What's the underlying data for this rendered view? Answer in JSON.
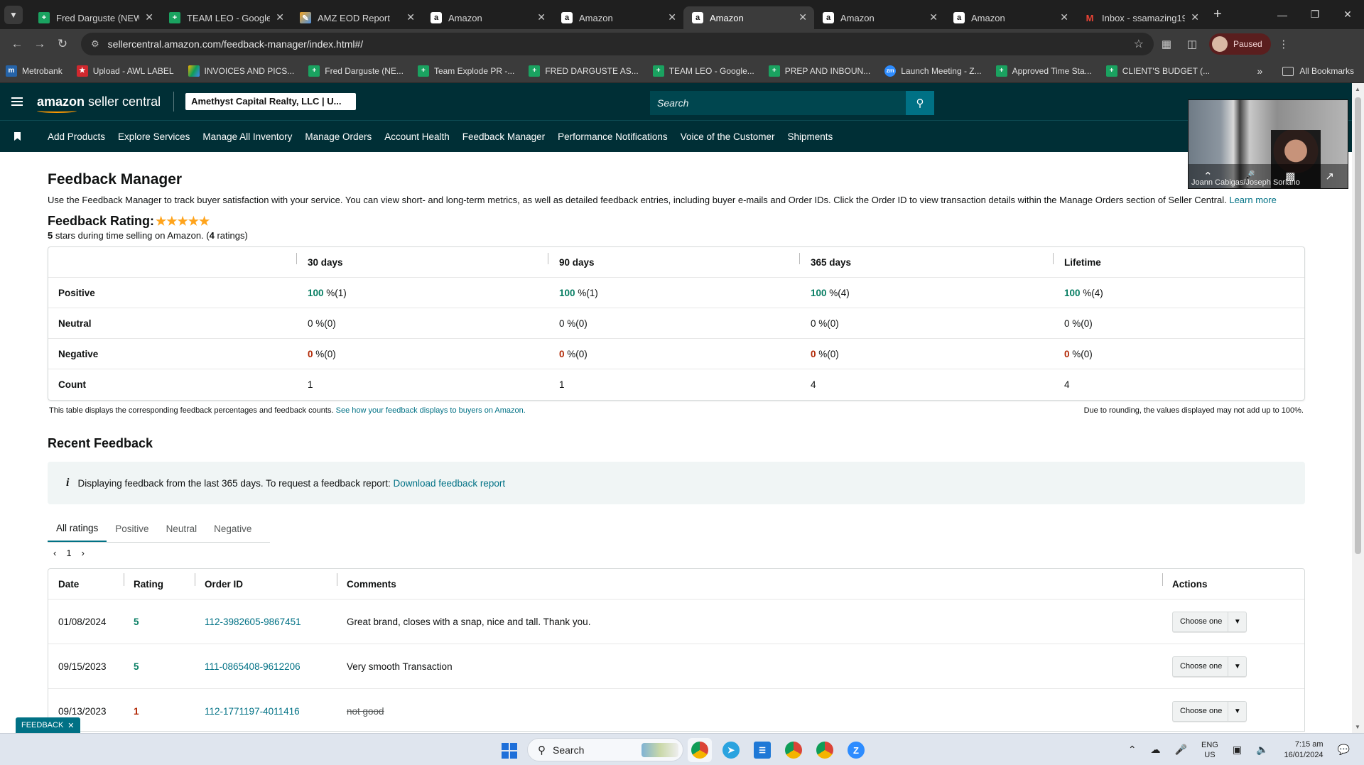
{
  "browser": {
    "tabs": [
      {
        "title": "Fred Darguste (NEW",
        "icon": "sheets-icon",
        "active": false
      },
      {
        "title": "TEAM LEO - Google S",
        "icon": "sheets-icon",
        "active": false
      },
      {
        "title": "AMZ EOD Report",
        "icon": "pen-icon",
        "active": false
      },
      {
        "title": "Amazon",
        "icon": "amazon-icon",
        "active": false
      },
      {
        "title": "Amazon",
        "icon": "amazon-icon",
        "active": false
      },
      {
        "title": "Amazon",
        "icon": "amazon-icon",
        "active": true
      },
      {
        "title": "Amazon",
        "icon": "amazon-icon",
        "active": false
      },
      {
        "title": "Amazon",
        "icon": "amazon-icon",
        "active": false
      },
      {
        "title": "Inbox - ssamazing19",
        "icon": "gmail-icon",
        "active": false
      }
    ],
    "url": "sellercentral.amazon.com/feedback-manager/index.html#/",
    "profile_label": "Paused",
    "bookmarks": [
      {
        "label": "Metrobank",
        "icon": "bank-icon"
      },
      {
        "label": "Upload - AWL LABEL",
        "icon": "awl-icon"
      },
      {
        "label": "INVOICES AND PICS...",
        "icon": "drive-icon"
      },
      {
        "label": "Fred Darguste (NE...",
        "icon": "sheets-icon"
      },
      {
        "label": "Team Explode PR -...",
        "icon": "sheets-icon"
      },
      {
        "label": "FRED DARGUSTE AS...",
        "icon": "sheets-icon"
      },
      {
        "label": "TEAM LEO - Google...",
        "icon": "sheets-icon"
      },
      {
        "label": "PREP AND INBOUN...",
        "icon": "sheets-icon"
      },
      {
        "label": "Launch Meeting - Z...",
        "icon": "zoom-icon"
      },
      {
        "label": "Approved Time Sta...",
        "icon": "sheets-icon"
      },
      {
        "label": "CLIENT'S BUDGET (...",
        "icon": "sheets-icon"
      }
    ],
    "all_bookmarks": "All Bookmarks"
  },
  "header": {
    "logo_bold": "amazon",
    "logo_rest": " seller central",
    "account": "Amethyst Capital Realty, LLC | U...",
    "search_placeholder": "Search"
  },
  "nav": [
    "Add Products",
    "Explore Services",
    "Manage All Inventory",
    "Manage Orders",
    "Account Health",
    "Feedback Manager",
    "Performance Notifications",
    "Voice of the Customer",
    "Shipments"
  ],
  "page": {
    "title": "Feedback Manager",
    "description": "Use the Feedback Manager to track buyer satisfaction with your service. You can view short- and long-term metrics, as well as detailed feedback entries, including buyer e-mails and Order IDs. Click the Order ID to view transaction details within the Manage Orders section of Seller Central.",
    "learn_more": "Learn more",
    "rating_label": "Feedback Rating:",
    "rating_stars": 5,
    "rating_sub_stars": "5",
    "rating_sub_mid": " stars during time selling on Amazon. (",
    "rating_sub_count": "4",
    "rating_sub_end": " ratings)"
  },
  "metrics": {
    "columns": [
      "30 days",
      "90 days",
      "365 days",
      "Lifetime"
    ],
    "rows": [
      {
        "label": "Positive",
        "kind": "pos",
        "cells": [
          [
            "100",
            " %(1)"
          ],
          [
            "100",
            " %(1)"
          ],
          [
            "100",
            " %(4)"
          ],
          [
            "100",
            " %(4)"
          ]
        ]
      },
      {
        "label": "Neutral",
        "kind": "neu",
        "cells": [
          [
            "0",
            " %(0)"
          ],
          [
            "0",
            " %(0)"
          ],
          [
            "0",
            " %(0)"
          ],
          [
            "0",
            " %(0)"
          ]
        ]
      },
      {
        "label": "Negative",
        "kind": "neg",
        "cells": [
          [
            "0",
            " %(0)"
          ],
          [
            "0",
            " %(0)"
          ],
          [
            "0",
            " %(0)"
          ],
          [
            "0",
            " %(0)"
          ]
        ]
      },
      {
        "label": "Count",
        "kind": "cnt",
        "cells": [
          [
            "",
            "1"
          ],
          [
            "",
            "1"
          ],
          [
            "",
            "4"
          ],
          [
            "",
            "4"
          ]
        ]
      }
    ],
    "foot_left": "This table displays the corresponding feedback percentages and feedback counts.",
    "foot_link": "See how your feedback displays to buyers on Amazon.",
    "foot_right": "Due to rounding, the values displayed may not add up to 100%."
  },
  "recent": {
    "title": "Recent Feedback",
    "info_text": "Displaying feedback from the last 365 days. To request a feedback report:",
    "info_link": "Download feedback report",
    "tabs": [
      "All ratings",
      "Positive",
      "Neutral",
      "Negative"
    ],
    "page": "1",
    "columns": [
      "Date",
      "Rating",
      "Order ID",
      "Comments",
      "Actions"
    ],
    "rows": [
      {
        "date": "01/08/2024",
        "rating": "5",
        "order": "112-3982605-9867451",
        "comment": "Great brand, closes with a snap, nice and tall. Thank you.",
        "struck": false
      },
      {
        "date": "09/15/2023",
        "rating": "5",
        "order": "111-0865408-9612206",
        "comment": "Very smooth Transaction",
        "struck": false
      },
      {
        "date": "09/13/2023",
        "rating": "1",
        "order": "112-1771197-4011416",
        "comment": "not good",
        "struck": true
      }
    ],
    "action_label": "Choose one"
  },
  "feedback_tab": "FEEDBACK",
  "video": {
    "name": "Joann Cabigas/Joseph Soriano"
  },
  "taskbar": {
    "search": "Search",
    "lang_top": "ENG",
    "lang_bottom": "US",
    "time": "7:15 am",
    "date": "16/01/2024"
  },
  "colors": {
    "header_bg": "#002f36",
    "link": "#007185",
    "positive": "#067d62",
    "negative": "#b12704",
    "star": "#ffa41c"
  }
}
